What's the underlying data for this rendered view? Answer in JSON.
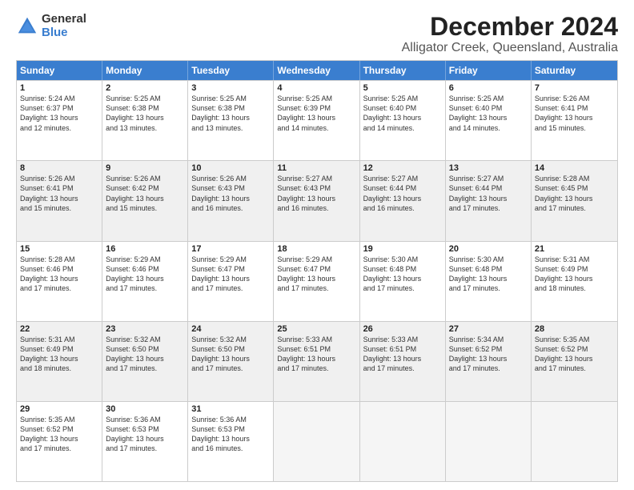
{
  "logo": {
    "general": "General",
    "blue": "Blue"
  },
  "title": "December 2024",
  "location": "Alligator Creek, Queensland, Australia",
  "header_days": [
    "Sunday",
    "Monday",
    "Tuesday",
    "Wednesday",
    "Thursday",
    "Friday",
    "Saturday"
  ],
  "weeks": [
    [
      {
        "day": "1",
        "text": "Sunrise: 5:24 AM\nSunset: 6:37 PM\nDaylight: 13 hours\nand 12 minutes.",
        "shaded": false
      },
      {
        "day": "2",
        "text": "Sunrise: 5:25 AM\nSunset: 6:38 PM\nDaylight: 13 hours\nand 13 minutes.",
        "shaded": false
      },
      {
        "day": "3",
        "text": "Sunrise: 5:25 AM\nSunset: 6:38 PM\nDaylight: 13 hours\nand 13 minutes.",
        "shaded": false
      },
      {
        "day": "4",
        "text": "Sunrise: 5:25 AM\nSunset: 6:39 PM\nDaylight: 13 hours\nand 14 minutes.",
        "shaded": false
      },
      {
        "day": "5",
        "text": "Sunrise: 5:25 AM\nSunset: 6:40 PM\nDaylight: 13 hours\nand 14 minutes.",
        "shaded": false
      },
      {
        "day": "6",
        "text": "Sunrise: 5:25 AM\nSunset: 6:40 PM\nDaylight: 13 hours\nand 14 minutes.",
        "shaded": false
      },
      {
        "day": "7",
        "text": "Sunrise: 5:26 AM\nSunset: 6:41 PM\nDaylight: 13 hours\nand 15 minutes.",
        "shaded": false
      }
    ],
    [
      {
        "day": "8",
        "text": "Sunrise: 5:26 AM\nSunset: 6:41 PM\nDaylight: 13 hours\nand 15 minutes.",
        "shaded": true
      },
      {
        "day": "9",
        "text": "Sunrise: 5:26 AM\nSunset: 6:42 PM\nDaylight: 13 hours\nand 15 minutes.",
        "shaded": true
      },
      {
        "day": "10",
        "text": "Sunrise: 5:26 AM\nSunset: 6:43 PM\nDaylight: 13 hours\nand 16 minutes.",
        "shaded": true
      },
      {
        "day": "11",
        "text": "Sunrise: 5:27 AM\nSunset: 6:43 PM\nDaylight: 13 hours\nand 16 minutes.",
        "shaded": true
      },
      {
        "day": "12",
        "text": "Sunrise: 5:27 AM\nSunset: 6:44 PM\nDaylight: 13 hours\nand 16 minutes.",
        "shaded": true
      },
      {
        "day": "13",
        "text": "Sunrise: 5:27 AM\nSunset: 6:44 PM\nDaylight: 13 hours\nand 17 minutes.",
        "shaded": true
      },
      {
        "day": "14",
        "text": "Sunrise: 5:28 AM\nSunset: 6:45 PM\nDaylight: 13 hours\nand 17 minutes.",
        "shaded": true
      }
    ],
    [
      {
        "day": "15",
        "text": "Sunrise: 5:28 AM\nSunset: 6:46 PM\nDaylight: 13 hours\nand 17 minutes.",
        "shaded": false
      },
      {
        "day": "16",
        "text": "Sunrise: 5:29 AM\nSunset: 6:46 PM\nDaylight: 13 hours\nand 17 minutes.",
        "shaded": false
      },
      {
        "day": "17",
        "text": "Sunrise: 5:29 AM\nSunset: 6:47 PM\nDaylight: 13 hours\nand 17 minutes.",
        "shaded": false
      },
      {
        "day": "18",
        "text": "Sunrise: 5:29 AM\nSunset: 6:47 PM\nDaylight: 13 hours\nand 17 minutes.",
        "shaded": false
      },
      {
        "day": "19",
        "text": "Sunrise: 5:30 AM\nSunset: 6:48 PM\nDaylight: 13 hours\nand 17 minutes.",
        "shaded": false
      },
      {
        "day": "20",
        "text": "Sunrise: 5:30 AM\nSunset: 6:48 PM\nDaylight: 13 hours\nand 17 minutes.",
        "shaded": false
      },
      {
        "day": "21",
        "text": "Sunrise: 5:31 AM\nSunset: 6:49 PM\nDaylight: 13 hours\nand 18 minutes.",
        "shaded": false
      }
    ],
    [
      {
        "day": "22",
        "text": "Sunrise: 5:31 AM\nSunset: 6:49 PM\nDaylight: 13 hours\nand 18 minutes.",
        "shaded": true
      },
      {
        "day": "23",
        "text": "Sunrise: 5:32 AM\nSunset: 6:50 PM\nDaylight: 13 hours\nand 17 minutes.",
        "shaded": true
      },
      {
        "day": "24",
        "text": "Sunrise: 5:32 AM\nSunset: 6:50 PM\nDaylight: 13 hours\nand 17 minutes.",
        "shaded": true
      },
      {
        "day": "25",
        "text": "Sunrise: 5:33 AM\nSunset: 6:51 PM\nDaylight: 13 hours\nand 17 minutes.",
        "shaded": true
      },
      {
        "day": "26",
        "text": "Sunrise: 5:33 AM\nSunset: 6:51 PM\nDaylight: 13 hours\nand 17 minutes.",
        "shaded": true
      },
      {
        "day": "27",
        "text": "Sunrise: 5:34 AM\nSunset: 6:52 PM\nDaylight: 13 hours\nand 17 minutes.",
        "shaded": true
      },
      {
        "day": "28",
        "text": "Sunrise: 5:35 AM\nSunset: 6:52 PM\nDaylight: 13 hours\nand 17 minutes.",
        "shaded": true
      }
    ],
    [
      {
        "day": "29",
        "text": "Sunrise: 5:35 AM\nSunset: 6:52 PM\nDaylight: 13 hours\nand 17 minutes.",
        "shaded": false
      },
      {
        "day": "30",
        "text": "Sunrise: 5:36 AM\nSunset: 6:53 PM\nDaylight: 13 hours\nand 17 minutes.",
        "shaded": false
      },
      {
        "day": "31",
        "text": "Sunrise: 5:36 AM\nSunset: 6:53 PM\nDaylight: 13 hours\nand 16 minutes.",
        "shaded": false
      },
      {
        "day": "",
        "text": "",
        "shaded": false,
        "empty": true
      },
      {
        "day": "",
        "text": "",
        "shaded": false,
        "empty": true
      },
      {
        "day": "",
        "text": "",
        "shaded": false,
        "empty": true
      },
      {
        "day": "",
        "text": "",
        "shaded": false,
        "empty": true
      }
    ]
  ]
}
